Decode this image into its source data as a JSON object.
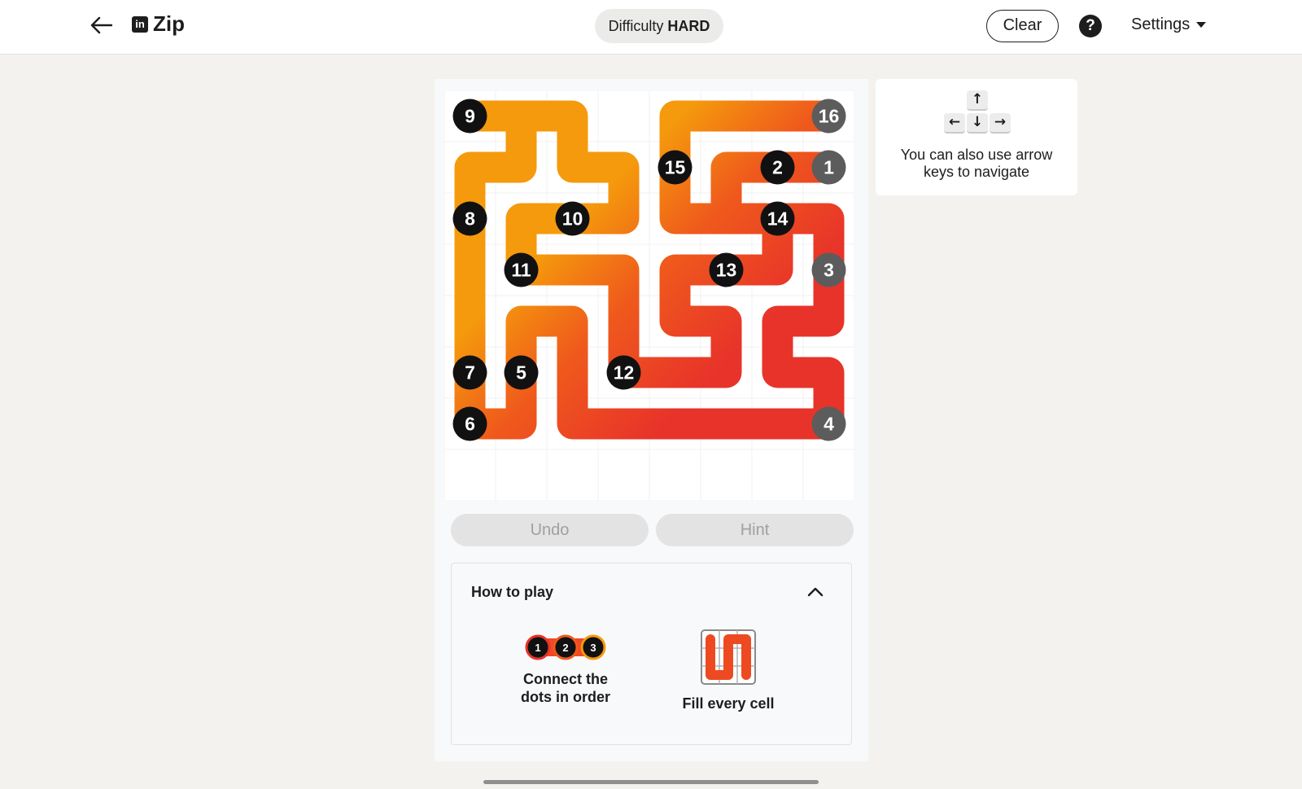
{
  "header": {
    "brand_logo": "in",
    "brand": "Zip",
    "difficulty_label": "Difficulty",
    "difficulty_value": "HARD",
    "clear_label": "Clear",
    "help_label": "?",
    "settings_label": "Settings"
  },
  "icons": {
    "back": "arrow-left-icon",
    "help": "question-circle-icon",
    "settings_caret": "caret-down-icon",
    "collapse": "chevron-up-icon",
    "keys": "arrow-keys-icon"
  },
  "puzzle": {
    "grid_size": 8,
    "path_colors": {
      "start": "#e8332a",
      "mid": "#ef5a1c",
      "end": "#f59a0c"
    },
    "dots": [
      {
        "n": "1",
        "row": 1,
        "col": 7,
        "state": "visited"
      },
      {
        "n": "2",
        "row": 1,
        "col": 6,
        "state": "pending"
      },
      {
        "n": "3",
        "row": 3,
        "col": 7,
        "state": "visited"
      },
      {
        "n": "4",
        "row": 6,
        "col": 7,
        "state": "visited"
      },
      {
        "n": "5",
        "row": 5,
        "col": 1,
        "state": "pending"
      },
      {
        "n": "6",
        "row": 6,
        "col": 0,
        "state": "pending"
      },
      {
        "n": "7",
        "row": 5,
        "col": 0,
        "state": "pending"
      },
      {
        "n": "8",
        "row": 2,
        "col": 0,
        "state": "pending"
      },
      {
        "n": "9",
        "row": 0,
        "col": 0,
        "state": "pending"
      },
      {
        "n": "10",
        "row": 2,
        "col": 2,
        "state": "pending"
      },
      {
        "n": "11",
        "row": 3,
        "col": 1,
        "state": "pending"
      },
      {
        "n": "12",
        "row": 5,
        "col": 3,
        "state": "pending"
      },
      {
        "n": "13",
        "row": 3,
        "col": 5,
        "state": "pending"
      },
      {
        "n": "14",
        "row": 2,
        "col": 6,
        "state": "pending"
      },
      {
        "n": "15",
        "row": 1,
        "col": 4,
        "state": "pending"
      },
      {
        "n": "16",
        "row": 0,
        "col": 7,
        "state": "visited"
      }
    ],
    "path": [
      [
        1,
        7
      ],
      [
        1,
        6
      ],
      [
        1,
        5
      ],
      [
        2,
        5
      ],
      [
        2,
        6
      ],
      [
        2,
        7
      ],
      [
        3,
        7
      ],
      [
        4,
        7
      ],
      [
        4,
        6
      ],
      [
        5,
        6
      ],
      [
        5,
        7
      ],
      [
        6,
        7
      ],
      [
        6,
        6
      ],
      [
        6,
        5
      ],
      [
        6,
        4
      ],
      [
        6,
        3
      ],
      [
        6,
        2
      ],
      [
        5,
        2
      ],
      [
        4,
        2
      ],
      [
        4,
        1
      ],
      [
        5,
        1
      ],
      [
        6,
        1
      ],
      [
        6,
        0
      ],
      [
        5,
        0
      ],
      [
        4,
        0
      ],
      [
        3,
        0
      ],
      [
        2,
        0
      ],
      [
        1,
        0
      ],
      [
        1,
        1
      ],
      [
        0,
        1
      ],
      [
        0,
        0
      ],
      [
        0,
        2
      ],
      [
        1,
        2
      ],
      [
        1,
        3
      ],
      [
        2,
        3
      ],
      [
        2,
        2
      ],
      [
        2,
        1
      ],
      [
        3,
        1
      ],
      [
        3,
        2
      ],
      [
        3,
        3
      ],
      [
        4,
        3
      ],
      [
        5,
        3
      ],
      [
        5,
        4
      ],
      [
        5,
        5
      ],
      [
        4,
        5
      ],
      [
        4,
        4
      ],
      [
        3,
        4
      ],
      [
        3,
        5
      ],
      [
        3,
        6
      ],
      [
        2,
        6
      ],
      [
        2,
        4
      ],
      [
        1,
        4
      ],
      [
        0,
        4
      ],
      [
        0,
        5
      ],
      [
        0,
        6
      ],
      [
        0,
        7
      ]
    ]
  },
  "controls": {
    "undo_label": "Undo",
    "hint_label": "Hint"
  },
  "how_to_play": {
    "title": "How to play",
    "item1_line1": "Connect the",
    "item1_line2": "dots in order",
    "item1_dots": [
      "1",
      "2",
      "3"
    ],
    "item2_label": "Fill every cell"
  },
  "tip": {
    "text": "You can also use arrow keys to navigate",
    "keys": [
      "↑",
      "←",
      "↓",
      "→"
    ]
  }
}
